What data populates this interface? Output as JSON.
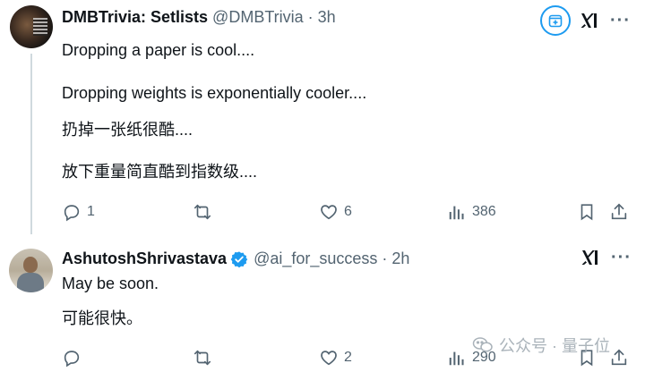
{
  "tweets": [
    {
      "author": {
        "name": "DMBTrivia: Setlists",
        "handle": "@DMBTrivia",
        "separator": "·",
        "time": "3h"
      },
      "lines": [
        "Dropping a paper is cool....",
        "Dropping weights is exponentially cooler....",
        "扔掉一张纸很酷....",
        "放下重量简直酷到指数级...."
      ],
      "stats": {
        "replies": "1",
        "retweets": "",
        "likes": "6",
        "views": "386"
      },
      "icons": [
        "grok-icon",
        "xai-icon",
        "more-icon"
      ]
    },
    {
      "author": {
        "name": "AshutoshShrivastava",
        "handle": "@ai_for_success",
        "separator": "·",
        "time": "2h",
        "verified": true
      },
      "lines": [
        "May be soon.",
        "可能很快。"
      ],
      "stats": {
        "replies": "",
        "retweets": "",
        "likes": "2",
        "views": "290"
      },
      "icons": [
        "xai-icon",
        "more-icon"
      ]
    }
  ],
  "more_glyph": "···",
  "watermark": {
    "text": "公众号 · 量子位"
  },
  "colors": {
    "accent": "#1d9bf0",
    "secondary_text": "#536471",
    "primary_text": "#0f1419",
    "thread_line": "#cfd9de"
  }
}
